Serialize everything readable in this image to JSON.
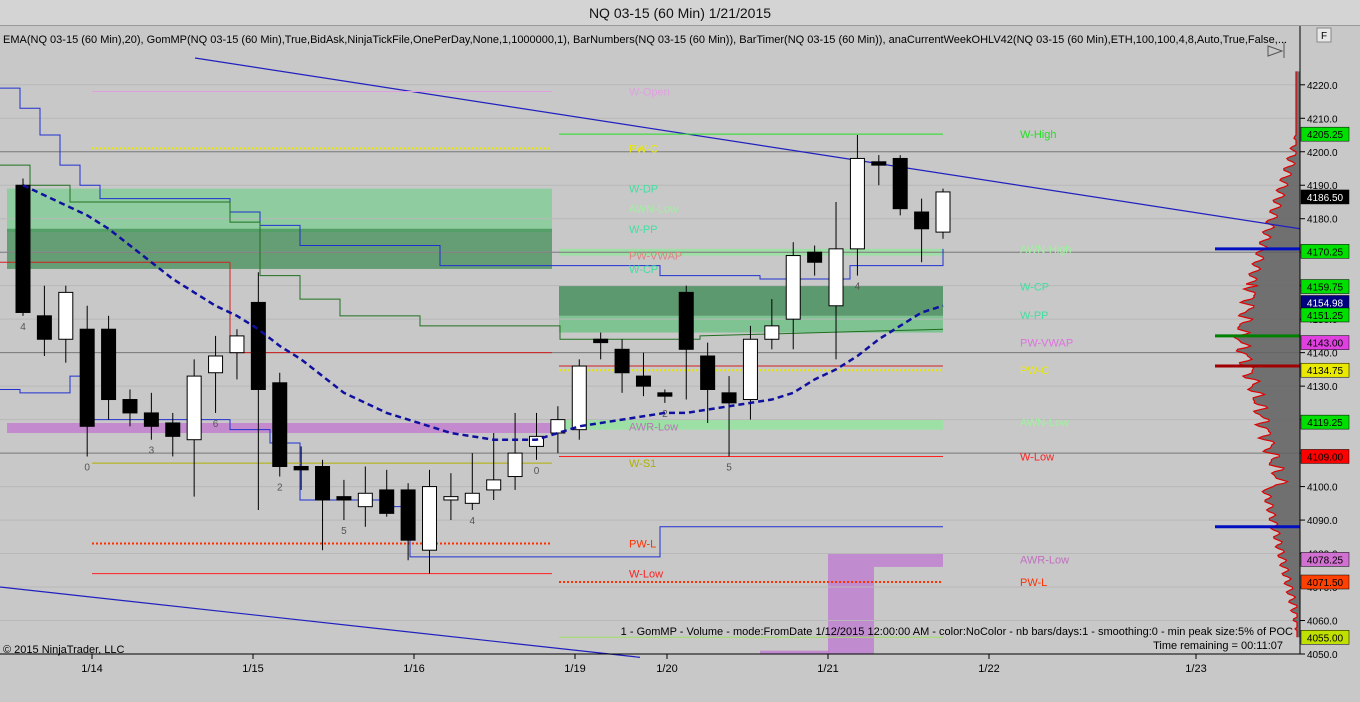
{
  "window": {
    "title": "NQ 03-15 (60 Min)  1/21/2015"
  },
  "indicator_line": "EMA(NQ 03-15 (60 Min),20), GomMP(NQ 03-15 (60 Min),True,BidAsk,NinjaTickFile,OnePerDay,None,1,1000000,1), BarNumbers(NQ 03-15 (60 Min)), BarTimer(NQ 03-15 (60 Min)), anaCurrentWeekOHLV42(NQ 03-15 (60 Min),ETH,100,100,4,8,Auto,True,False,...",
  "copyright": "© 2015 NinjaTrader, LLC",
  "profile_info": "1 - GomMP - Volume - mode:FromDate 1/12/2015 12:00:00 AM - color:NoColor - nb bars/days:1 - smoothing:0 - min peak size:5% of POC",
  "time_remaining": "Time remaining = 00:11:07",
  "f_button": "F",
  "colors": {
    "background": "#c8c8c8",
    "up_candle": "#ffffff",
    "down_candle": "#000000",
    "ema": "#1010a0",
    "trendline": "#2020c0"
  },
  "chart_data": {
    "type": "candlestick",
    "instrument": "NQ 03-15",
    "timeframe": "60 Min",
    "x_ticks": [
      "1/14",
      "1/15",
      "1/16",
      "1/19",
      "1/20",
      "1/21",
      "1/22",
      "1/23"
    ],
    "y_range": [
      4050,
      4228
    ],
    "y_ticks": [
      4050,
      4060,
      4070,
      4080,
      4090,
      4100,
      4110,
      4120,
      4130,
      4140,
      4150,
      4160,
      4170,
      4180,
      4190,
      4200,
      4210,
      4220
    ],
    "candles": [
      {
        "o": 4190,
        "h": 4192,
        "l": 4151,
        "c": 4152
      },
      {
        "o": 4151,
        "h": 4160,
        "l": 4139,
        "c": 4144
      },
      {
        "o": 4144,
        "h": 4160,
        "l": 4137,
        "c": 4158
      },
      {
        "o": 4147,
        "h": 4154,
        "l": 4109,
        "c": 4118
      },
      {
        "o": 4147,
        "h": 4151,
        "l": 4120,
        "c": 4126
      },
      {
        "o": 4126,
        "h": 4129,
        "l": 4118,
        "c": 4122
      },
      {
        "o": 4122,
        "h": 4128,
        "l": 4114,
        "c": 4118
      },
      {
        "o": 4119,
        "h": 4122,
        "l": 4109,
        "c": 4115
      },
      {
        "o": 4114,
        "h": 4138,
        "l": 4097,
        "c": 4133
      },
      {
        "o": 4134,
        "h": 4145,
        "l": 4122,
        "c": 4139
      },
      {
        "o": 4140,
        "h": 4147,
        "l": 4132,
        "c": 4145
      },
      {
        "o": 4155,
        "h": 4164,
        "l": 4093,
        "c": 4129
      },
      {
        "o": 4131,
        "h": 4134,
        "l": 4103,
        "c": 4106
      },
      {
        "o": 4106,
        "h": 4112,
        "l": 4099,
        "c": 4105
      },
      {
        "o": 4106,
        "h": 4108,
        "l": 4081,
        "c": 4096
      },
      {
        "o": 4097,
        "h": 4102,
        "l": 4090,
        "c": 4096
      },
      {
        "o": 4094,
        "h": 4106,
        "l": 4088,
        "c": 4098
      },
      {
        "o": 4099,
        "h": 4105,
        "l": 4091,
        "c": 4092
      },
      {
        "o": 4099,
        "h": 4101,
        "l": 4078,
        "c": 4084
      },
      {
        "o": 4081,
        "h": 4105,
        "l": 4074,
        "c": 4100
      },
      {
        "o": 4096,
        "h": 4104,
        "l": 4090,
        "c": 4097
      },
      {
        "o": 4095,
        "h": 4110,
        "l": 4093,
        "c": 4098
      },
      {
        "o": 4099,
        "h": 4116,
        "l": 4096,
        "c": 4102
      },
      {
        "o": 4103,
        "h": 4122,
        "l": 4099,
        "c": 4110
      },
      {
        "o": 4112,
        "h": 4122,
        "l": 4108,
        "c": 4115
      },
      {
        "o": 4116,
        "h": 4124,
        "l": 4110,
        "c": 4120
      },
      {
        "o": 4117,
        "h": 4138,
        "l": 4114,
        "c": 4136
      },
      {
        "o": 4144,
        "h": 4146,
        "l": 4138,
        "c": 4143
      },
      {
        "o": 4141,
        "h": 4144,
        "l": 4128,
        "c": 4134
      },
      {
        "o": 4133,
        "h": 4140,
        "l": 4127,
        "c": 4130
      },
      {
        "o": 4128,
        "h": 4129,
        "l": 4125,
        "c": 4127
      },
      {
        "o": 4158,
        "h": 4160,
        "l": 4126,
        "c": 4141
      },
      {
        "o": 4139,
        "h": 4143,
        "l": 4119,
        "c": 4129
      },
      {
        "o": 4128,
        "h": 4133,
        "l": 4109,
        "c": 4125
      },
      {
        "o": 4126,
        "h": 4148,
        "l": 4120,
        "c": 4144
      },
      {
        "o": 4144,
        "h": 4156,
        "l": 4141,
        "c": 4148
      },
      {
        "o": 4150,
        "h": 4173,
        "l": 4141,
        "c": 4169
      },
      {
        "o": 4170,
        "h": 4172,
        "l": 4163,
        "c": 4167
      },
      {
        "o": 4154,
        "h": 4185,
        "l": 4138,
        "c": 4171
      },
      {
        "o": 4171,
        "h": 4205,
        "l": 4163,
        "c": 4198
      },
      {
        "o": 4197,
        "h": 4199,
        "l": 4190,
        "c": 4196
      },
      {
        "o": 4198,
        "h": 4199,
        "l": 4181,
        "c": 4183
      },
      {
        "o": 4182,
        "h": 4186,
        "l": 4167,
        "c": 4177
      },
      {
        "o": 4176,
        "h": 4189,
        "l": 4174,
        "c": 4188
      }
    ],
    "bar_numbers": [
      {
        "bar": 0,
        "label": "4"
      },
      {
        "bar": 3,
        "label": "0"
      },
      {
        "bar": 6,
        "label": "3"
      },
      {
        "bar": 9,
        "label": "6"
      },
      {
        "bar": 12,
        "label": "2"
      },
      {
        "bar": 15,
        "label": "5"
      },
      {
        "bar": 21,
        "label": "4"
      },
      {
        "bar": 24,
        "label": "0"
      },
      {
        "bar": 30,
        "label": "2"
      },
      {
        "bar": 33,
        "label": "5"
      },
      {
        "bar": 39,
        "label": "4"
      }
    ],
    "ema_values": [
      4190,
      4187,
      4184,
      4181,
      4177,
      4172,
      4167,
      4162,
      4158,
      4154,
      4151,
      4147,
      4142,
      4138,
      4133,
      4128,
      4125,
      4122,
      4120,
      4118,
      4116,
      4115,
      4114,
      4114,
      4114,
      4116,
      4118,
      4119,
      4120,
      4121,
      4122,
      4122,
      4123,
      4124,
      4125,
      4126,
      4128,
      4132,
      4135,
      4139,
      4144,
      4148,
      4152,
      4154
    ],
    "prior_levels": [
      {
        "label": "W-Open",
        "y": 4218,
        "color": "#e0a0e0",
        "style": "solid"
      },
      {
        "label": "PW-C",
        "y": 4201,
        "color": "#e8e800",
        "style": "dotted"
      },
      {
        "label": "W-DP",
        "y": 4189,
        "color": "#40e0a0",
        "style": "none"
      },
      {
        "label": "AWN-Low",
        "y": 4183,
        "color": "#a0f0a0",
        "style": "none"
      },
      {
        "label": "W-PP",
        "y": 4177,
        "color": "#40e0a0",
        "style": "none"
      },
      {
        "label": "PW-VWAP",
        "y": 4169,
        "color": "#e08080",
        "style": "none"
      },
      {
        "label": "W-CP",
        "y": 4165,
        "color": "#40e0a0",
        "style": "none"
      },
      {
        "label": "AWR-Low",
        "y": 4118,
        "color": "#c070c0",
        "style": "none"
      },
      {
        "label": "W-S1",
        "y": 4107,
        "color": "#b0b000",
        "style": "solid"
      },
      {
        "label": "PW-L",
        "y": 4083,
        "color": "#ff3000",
        "style": "dotted"
      },
      {
        "label": "W-Low",
        "y": 4074,
        "color": "#ff2020",
        "style": "solid"
      }
    ],
    "current_levels": [
      {
        "label": "W-High",
        "y": 4205.25,
        "color": "#20e020",
        "style": "solid"
      },
      {
        "label": "AWN-High",
        "y": 4171,
        "color": "#a0f0a0",
        "style": "none"
      },
      {
        "label": "W-CP",
        "y": 4159.75,
        "color": "#40e0a0",
        "style": "none"
      },
      {
        "label": "W-PP",
        "y": 4151.25,
        "color": "#40e0a0",
        "style": "none"
      },
      {
        "label": "PW-VWAP",
        "y": 4143,
        "color": "#e070e0",
        "style": "none"
      },
      {
        "label": "PW-C",
        "y": 4134.75,
        "color": "#e8e800",
        "style": "dotted"
      },
      {
        "label": "AWN-Low",
        "y": 4119.25,
        "color": "#a0f0a0",
        "style": "none"
      },
      {
        "label": "W-Low",
        "y": 4109,
        "color": "#ff2020",
        "style": "solid"
      },
      {
        "label": "AWR-Low",
        "y": 4078.25,
        "color": "#c070c0",
        "style": "none"
      },
      {
        "label": "PW-L",
        "y": 4071.5,
        "color": "#ff3000",
        "style": "dotted"
      },
      {
        "label": "",
        "y": 4055,
        "color": "#a0e060",
        "style": "solid"
      }
    ],
    "price_tags": [
      {
        "value": "4205.25",
        "bg": "#00e000",
        "fg": "#000000"
      },
      {
        "value": "4186.50",
        "bg": "#000000",
        "fg": "#ffffff"
      },
      {
        "value": "4170.25",
        "bg": "#00e000",
        "fg": "#000000"
      },
      {
        "value": "4159.75",
        "bg": "#00e000",
        "fg": "#000000"
      },
      {
        "value": "4154.98",
        "bg": "#000080",
        "fg": "#ffffff"
      },
      {
        "value": "4151.25",
        "bg": "#00e000",
        "fg": "#000000"
      },
      {
        "value": "4143.00",
        "bg": "#e040e0",
        "fg": "#000000"
      },
      {
        "value": "4134.75",
        "bg": "#e8e800",
        "fg": "#000000"
      },
      {
        "value": "4119.25",
        "bg": "#00e000",
        "fg": "#000000"
      },
      {
        "value": "4109.00",
        "bg": "#ff0000",
        "fg": "#000000"
      },
      {
        "value": "4078.25",
        "bg": "#d070d0",
        "fg": "#000000"
      },
      {
        "value": "4071.50",
        "bg": "#ff4000",
        "fg": "#000000"
      },
      {
        "value": "4055.00",
        "bg": "#c0e000",
        "fg": "#000000"
      }
    ],
    "volume_profile_markers": [
      {
        "y": 4171,
        "color": "#0010c0"
      },
      {
        "y": 4145,
        "color": "#008000"
      },
      {
        "y": 4136,
        "color": "#a00000"
      },
      {
        "y": 4088,
        "color": "#0010c0"
      }
    ]
  }
}
